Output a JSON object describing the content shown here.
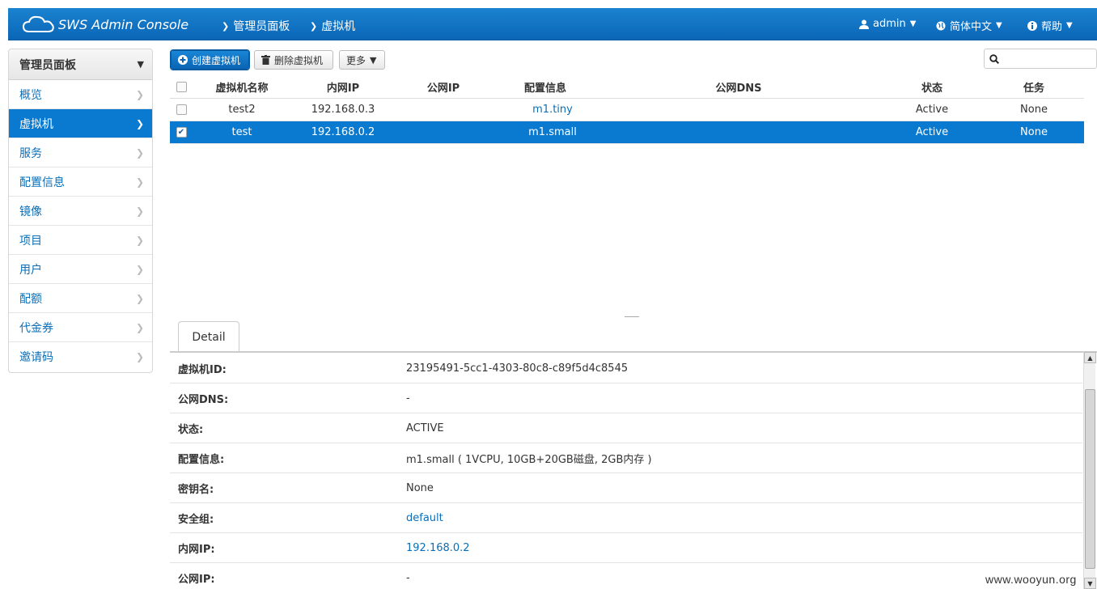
{
  "header": {
    "brand": "SWS Admin Console",
    "breadcrumbs": [
      "管理员面板",
      "虚拟机"
    ],
    "user": "admin",
    "language": "简体中文",
    "help": "帮助"
  },
  "sidebar": {
    "title": "管理员面板",
    "items": [
      {
        "label": "概览"
      },
      {
        "label": "虚拟机",
        "active": true
      },
      {
        "label": "服务"
      },
      {
        "label": "配置信息"
      },
      {
        "label": "镜像"
      },
      {
        "label": "项目"
      },
      {
        "label": "用户"
      },
      {
        "label": "配额"
      },
      {
        "label": "代金券"
      },
      {
        "label": "邀请码"
      }
    ]
  },
  "toolbar": {
    "create_label": "创建虚拟机",
    "delete_label": "删除虚拟机",
    "more_label": "更多",
    "search_placeholder": ""
  },
  "table": {
    "columns": [
      "虚拟机名称",
      "内网IP",
      "公网IP",
      "配置信息",
      "公网DNS",
      "状态",
      "任务"
    ],
    "rows": [
      {
        "name": "test2",
        "private_ip": "192.168.0.3",
        "public_ip": "",
        "flavor": "m1.tiny",
        "dns": "",
        "status": "Active",
        "task": "None",
        "selected": false
      },
      {
        "name": "test",
        "private_ip": "192.168.0.2",
        "public_ip": "",
        "flavor": "m1.small",
        "dns": "",
        "status": "Active",
        "task": "None",
        "selected": true
      }
    ]
  },
  "detail": {
    "tab_label": "Detail",
    "rows": [
      {
        "label": "虚拟机ID:",
        "value": "23195491-5cc1-4303-80c8-c89f5d4c8545"
      },
      {
        "label": "公网DNS:",
        "value": "-"
      },
      {
        "label": "状态:",
        "value": "ACTIVE"
      },
      {
        "label": "配置信息:",
        "value": "m1.small ( 1VCPU, 10GB+20GB磁盘, 2GB内存 )"
      },
      {
        "label": "密钥名:",
        "value": "None"
      },
      {
        "label": "安全组:",
        "value": "default",
        "link": true
      },
      {
        "label": "内网IP:",
        "value": "192.168.0.2",
        "link": true
      },
      {
        "label": "公网IP:",
        "value": "-"
      }
    ]
  },
  "watermark": "www.wooyun.org",
  "colors": {
    "nav": "#0b66b8",
    "accent": "#0a7ad0",
    "link": "#0a6fb8"
  },
  "icons": {
    "brand": "cloud-icon",
    "user": "user-icon",
    "language": "globe-icon",
    "help": "info-icon",
    "search": "search-icon"
  }
}
